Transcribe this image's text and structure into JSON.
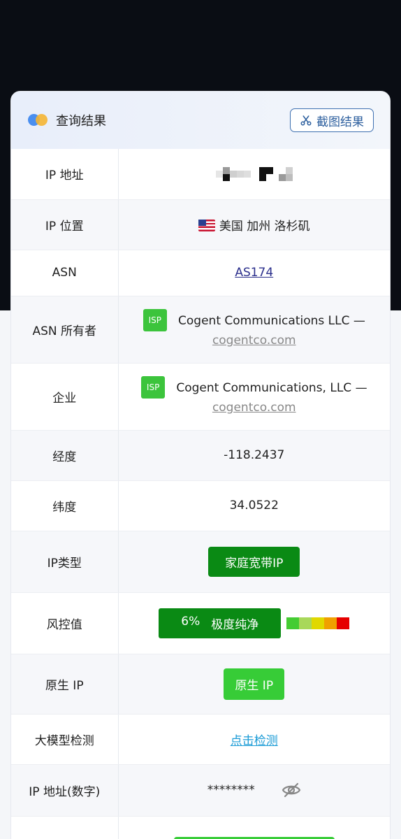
{
  "header": {
    "title": "查询结果",
    "screenshot_button": "截图结果"
  },
  "rows": {
    "ip_address": {
      "label": "IP 地址"
    },
    "ip_location": {
      "label": "IP 位置",
      "value": "美国 加州 洛杉矶",
      "flag": "us-flag"
    },
    "asn": {
      "label": "ASN",
      "value": "AS174"
    },
    "asn_owner": {
      "label": "ASN 所有者",
      "badge": "ISP",
      "name": "Cogent Communications LLC —",
      "domain": "cogentco.com"
    },
    "enterprise": {
      "label": "企业",
      "badge": "ISP",
      "name": "Cogent Communications, LLC —",
      "domain": "cogentco.com"
    },
    "longitude": {
      "label": "经度",
      "value": "-118.2437"
    },
    "latitude": {
      "label": "纬度",
      "value": "34.0522"
    },
    "ip_type": {
      "label": "IP类型",
      "value": "家庭宽带IP"
    },
    "risk": {
      "label": "风控值",
      "percent": "6%",
      "text": "极度纯净",
      "scale_colors": [
        "#44cc33",
        "#a8d85a",
        "#e0d800",
        "#f0a000",
        "#e60000"
      ]
    },
    "native_ip": {
      "label": "原生 IP",
      "value": "原生 IP"
    },
    "llm_detect": {
      "label": "大模型检测",
      "value": "点击检测"
    },
    "ip_numeric": {
      "label": "IP 地址(数字)",
      "value": "********"
    }
  },
  "colors": {
    "dark_bg": "#0a0d14",
    "accent_blue": "#2d5f9e",
    "green_dark": "#0a8a14",
    "green_light": "#37cc37"
  }
}
